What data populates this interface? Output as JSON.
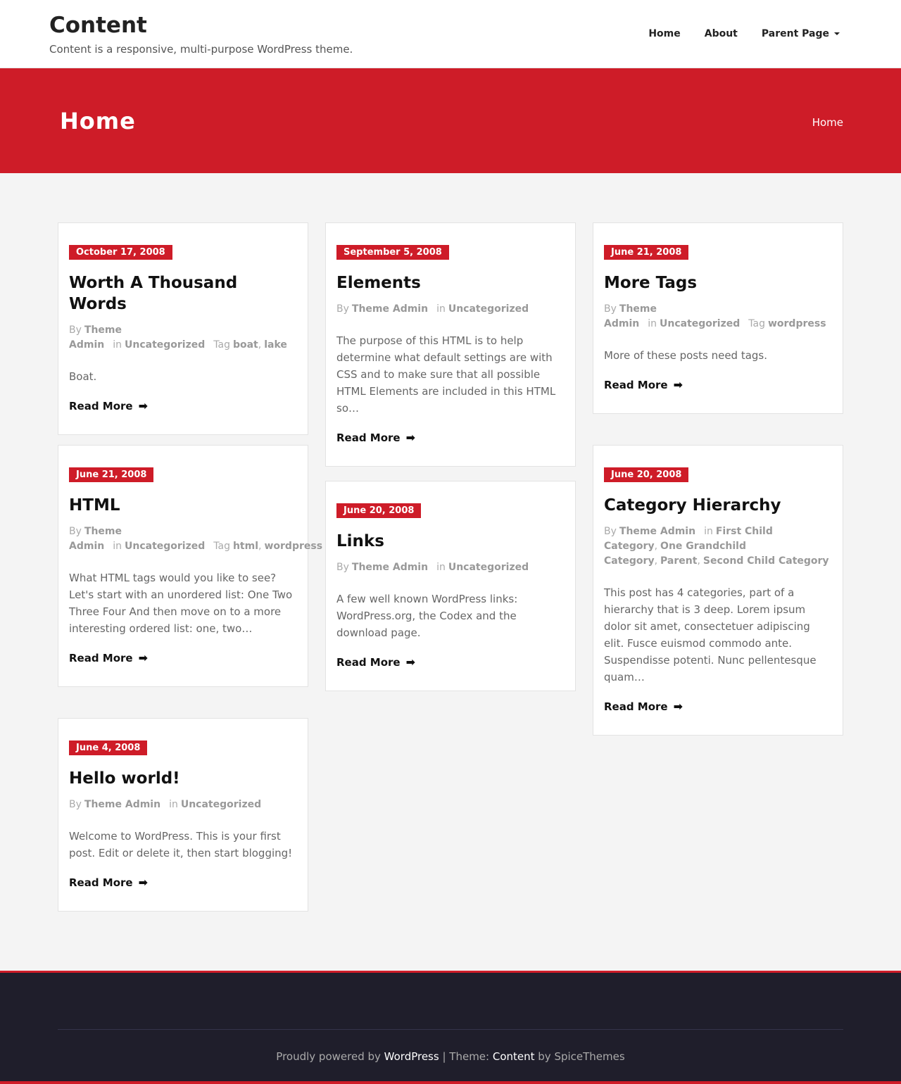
{
  "header": {
    "site_title": "Content",
    "site_description": "Content is a responsive, multi-purpose WordPress theme.",
    "nav": [
      {
        "label": "Home"
      },
      {
        "label": "About"
      },
      {
        "label": "Parent Page"
      }
    ]
  },
  "banner": {
    "title": "Home",
    "breadcrumb": "Home"
  },
  "labels": {
    "by": "By",
    "in": "in",
    "tag": "Tag",
    "read_more": "Read More",
    "arrow": "➡"
  },
  "posts": [
    {
      "date": "October 17, 2008",
      "title": "Worth A Thousand Words",
      "author": "Theme Admin",
      "categories": [
        "Uncategorized"
      ],
      "tags": [
        "boat",
        "lake"
      ],
      "excerpt": "Boat."
    },
    {
      "date": "September 5, 2008",
      "title": "Elements",
      "author": "Theme Admin",
      "categories": [
        "Uncategorized"
      ],
      "tags": [],
      "excerpt": "The purpose of this HTML is to help determine what default settings are with CSS and to make sure that all possible HTML Elements are included in this HTML so…"
    },
    {
      "date": "June 21, 2008",
      "title": "More Tags",
      "author": "Theme Admin",
      "categories": [
        "Uncategorized"
      ],
      "tags": [
        "wordpress"
      ],
      "excerpt": "More of these posts need tags."
    },
    {
      "date": "June 21, 2008",
      "title": "HTML",
      "author": "Theme Admin",
      "categories": [
        "Uncategorized"
      ],
      "tags": [
        "html",
        "wordpress"
      ],
      "excerpt": "What HTML tags would you like to see? Let's start with an unordered list: One Two Three Four And then move on to a more interesting ordered list: one, two…"
    },
    {
      "date": "June 20, 2008",
      "title": "Links",
      "author": "Theme Admin",
      "categories": [
        "Uncategorized"
      ],
      "tags": [],
      "excerpt": "A few well known WordPress links: WordPress.org, the Codex and the download page."
    },
    {
      "date": "June 20, 2008",
      "title": "Category Hierarchy",
      "author": "Theme Admin",
      "categories": [
        "First Child Category",
        "One Grandchild Category",
        "Parent",
        "Second Child Category"
      ],
      "tags": [],
      "excerpt": "This post has 4 categories, part of a hierarchy that is 3 deep. Lorem ipsum dolor sit amet, consectetuer adipiscing elit. Fusce euismod commodo ante. Suspendisse potenti. Nunc pellentesque quam…"
    },
    {
      "date": "June 4, 2008",
      "title": "Hello world!",
      "author": "Theme Admin",
      "categories": [
        "Uncategorized"
      ],
      "tags": [],
      "excerpt": "Welcome to WordPress. This is your first post. Edit or delete it, then start blogging!"
    }
  ],
  "footer": {
    "powered_prefix": "Proudly powered by ",
    "wordpress_link": "WordPress",
    "separator": " | Theme: ",
    "theme_link": "Content",
    "by_text": " by SpiceThemes"
  },
  "colors": {
    "accent": "#ce1c28",
    "footer_bg": "#1f1e2b",
    "page_bg": "#f4f4f4"
  }
}
